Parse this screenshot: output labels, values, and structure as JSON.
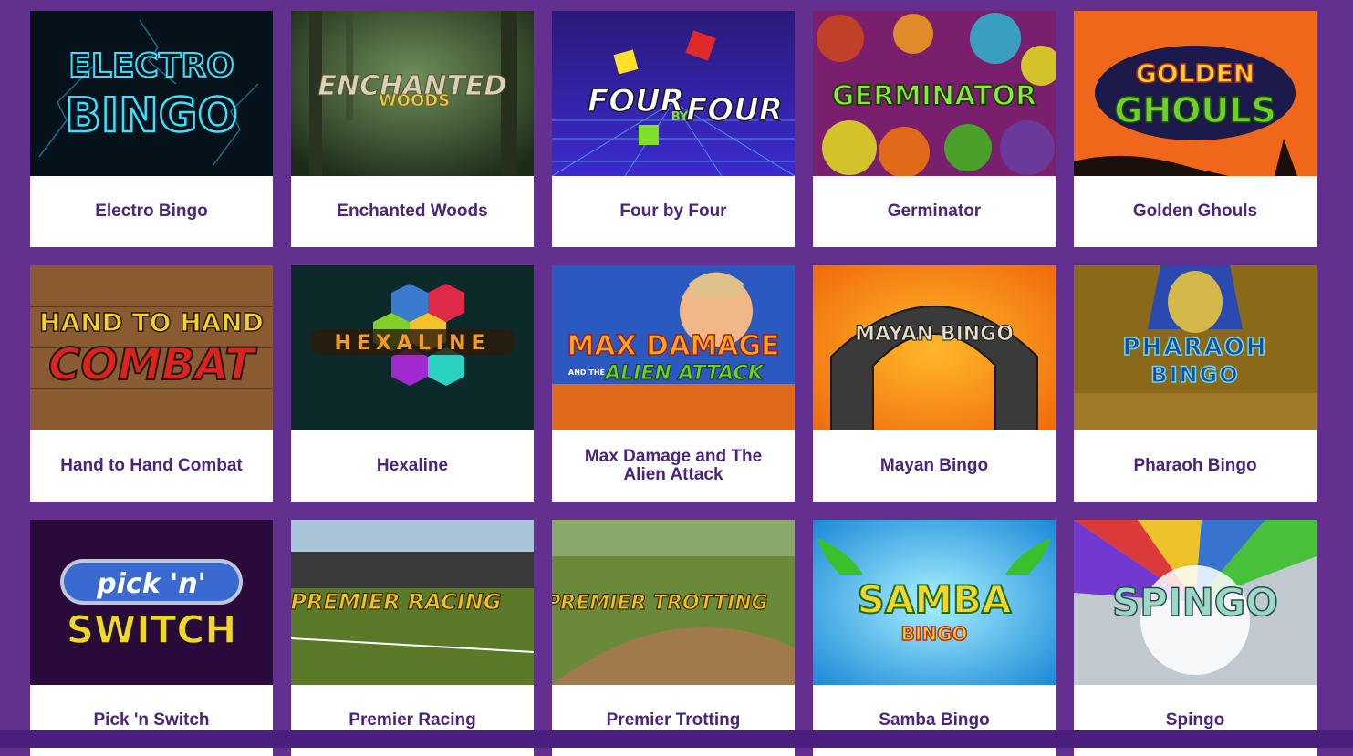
{
  "games": [
    {
      "title": "Electro Bingo",
      "art": [
        "ELECTRO",
        "BINGO"
      ]
    },
    {
      "title": "Enchanted Woods",
      "art": [
        "ENCHANTED",
        "WOODS"
      ]
    },
    {
      "title": "Four by Four",
      "art": [
        "FOUR",
        "BY",
        "FOUR"
      ]
    },
    {
      "title": "Germinator",
      "art": [
        "GERMINATOR"
      ]
    },
    {
      "title": "Golden Ghouls",
      "art": [
        "GOLDEN",
        "GHOULS"
      ]
    },
    {
      "title": "Hand to Hand Combat",
      "art": [
        "HAND TO HAND",
        "COMBAT"
      ]
    },
    {
      "title": "Hexaline",
      "art": [
        "HEXALINE"
      ]
    },
    {
      "title": "Max Damage and The Alien Attack",
      "art": [
        "MAX DAMAGE",
        "AND THE",
        "ALIEN ATTACK"
      ]
    },
    {
      "title": "Mayan Bingo",
      "art": [
        "MAYAN BINGO"
      ]
    },
    {
      "title": "Pharaoh Bingo",
      "art": [
        "PHARAOH",
        "BINGO"
      ]
    },
    {
      "title": "Pick 'n Switch",
      "art": [
        "pick 'n'",
        "SWITCH"
      ]
    },
    {
      "title": "Premier Racing",
      "art": [
        "PREMIER RACING"
      ]
    },
    {
      "title": "Premier Trotting",
      "art": [
        "PREMIER TROTTING"
      ]
    },
    {
      "title": "Samba Bingo",
      "art": [
        "SAMBA",
        "BINGO"
      ]
    },
    {
      "title": "Spingo",
      "art": [
        "SPINGO"
      ]
    }
  ],
  "colors": {
    "page_background": "#63308f",
    "caption_text": "#4b2678",
    "card_background": "#ffffff"
  }
}
